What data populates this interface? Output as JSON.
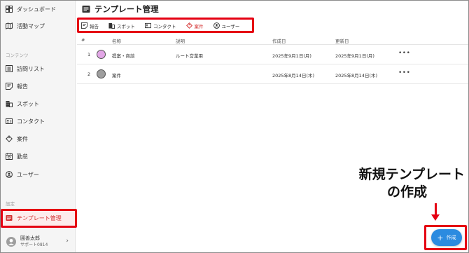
{
  "sidebar": {
    "items": [
      {
        "label": "ダッシュボード",
        "icon": "dashboard-icon"
      },
      {
        "label": "活動マップ",
        "icon": "map-icon"
      }
    ],
    "section_contents": "コンテンツ",
    "content_items": [
      {
        "label": "訪問リスト",
        "icon": "list-icon"
      },
      {
        "label": "報告",
        "icon": "report-icon"
      },
      {
        "label": "スポット",
        "icon": "building-icon"
      },
      {
        "label": "コンタクト",
        "icon": "contact-card-icon"
      },
      {
        "label": "案件",
        "icon": "deal-tag-icon"
      },
      {
        "label": "勤怠",
        "icon": "attendance-icon"
      },
      {
        "label": "ユーザー",
        "icon": "user-circle-icon"
      }
    ],
    "section_settings": "設定",
    "settings_items": [
      {
        "label": "テンプレート管理",
        "icon": "template-icon",
        "active": true
      }
    ],
    "user": {
      "name": "圓善太郎",
      "sub": "サポート0814"
    }
  },
  "header": {
    "title": "テンプレート管理"
  },
  "tabs": [
    {
      "label": "報告",
      "icon": "report-icon"
    },
    {
      "label": "スポット",
      "icon": "building-icon"
    },
    {
      "label": "コンタクト",
      "icon": "contact-card-icon"
    },
    {
      "label": "案件",
      "icon": "deal-tag-icon",
      "active": true
    },
    {
      "label": "ユーザー",
      "icon": "user-circle-icon"
    }
  ],
  "table": {
    "columns": [
      "#",
      "名称",
      "説明",
      "作成日",
      "更新日"
    ],
    "rows": [
      {
        "num": "1",
        "color": "#e2a6e6",
        "name": "提案・商談",
        "description": "ルート営業用",
        "created": "2025年9月1日(月)",
        "updated": "2025年9月1日(月)",
        "menu": "•••"
      },
      {
        "num": "2",
        "color": "#9e9e9e",
        "name": "案件",
        "description": "",
        "created": "2025年8月14日(木)",
        "updated": "2025年8月14日(木)",
        "menu": "•••"
      }
    ]
  },
  "annotation": {
    "line1": "新規テンプレート",
    "line2": "の作成"
  },
  "fab": {
    "label": "作成"
  },
  "colors": {
    "accent_red": "#e50012",
    "active_text": "#d32f2f",
    "fab_blue": "#2b8be0"
  }
}
